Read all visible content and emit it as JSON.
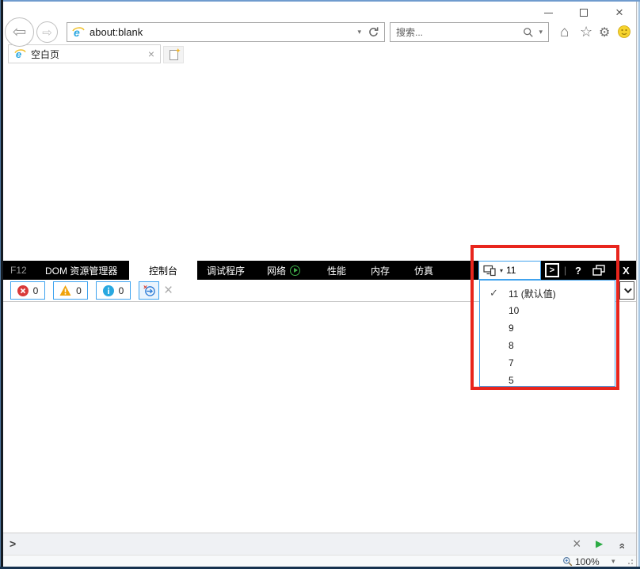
{
  "titlebar": {
    "close_glyph": "×"
  },
  "browser": {
    "url": "about:blank",
    "search_placeholder": "搜索...",
    "tab_title": "空白页",
    "zoom": "100%"
  },
  "devtools": {
    "tabs": {
      "f12": "F12",
      "dom": "DOM 资源管理器",
      "console": "控制台",
      "debugger": "调试程序",
      "network": "网络",
      "performance": "性能",
      "memory": "内存",
      "emulation": "仿真"
    },
    "header": {
      "help": "?",
      "close": "X",
      "launch_glyph": ">"
    },
    "doc_mode": {
      "current": "11",
      "options": [
        "11 (默认值)",
        "10",
        "9",
        "8",
        "7",
        "5"
      ]
    },
    "console_toolbar": {
      "error_count": "0",
      "warning_count": "0",
      "info_count": "0"
    },
    "command_prompt": ">"
  },
  "icons": {
    "back": "⇦",
    "forward": "⇨",
    "dropdown": "▾",
    "home": "⌂",
    "favorites": "☆",
    "tools": "⚙",
    "tab_close": "×",
    "check": "✓",
    "clear": "×",
    "cmd_close": "×",
    "double_chevron": "»",
    "play": "▶"
  },
  "colors": {
    "accent_blue": "#41a3ee",
    "annotation_red": "#e8251d",
    "error_red": "#d93a3a",
    "warning_orange": "#f0a30a",
    "info_blue": "#28a8e0",
    "network_green": "#3fae49"
  }
}
